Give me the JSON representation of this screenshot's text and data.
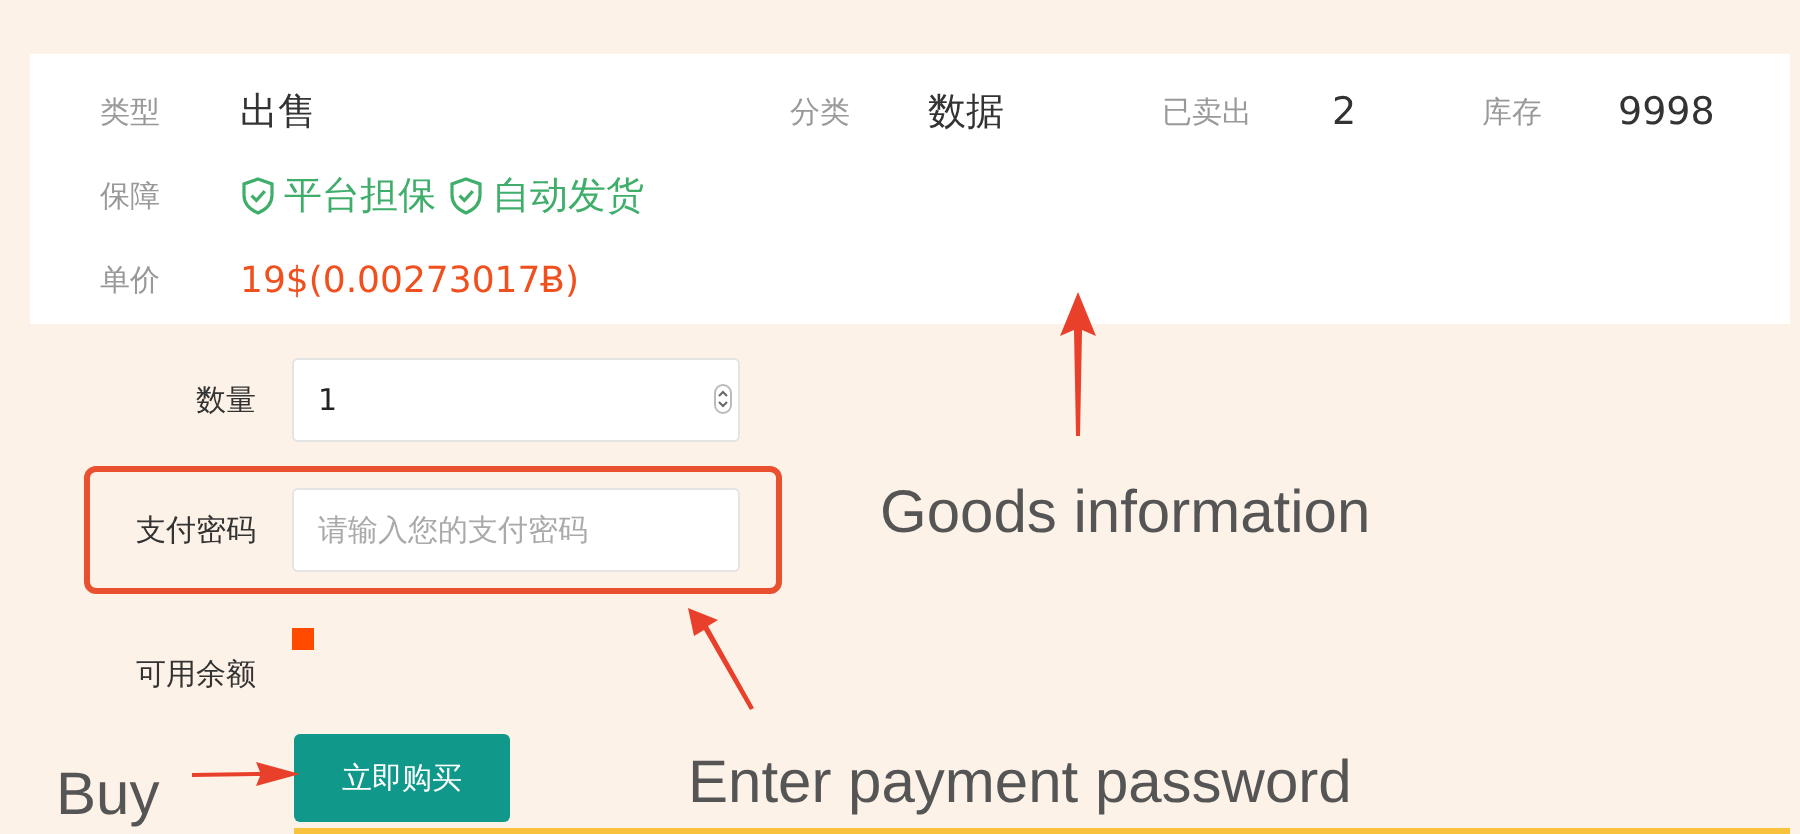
{
  "info": {
    "row1": [
      {
        "label": "类型",
        "value": "出售"
      },
      {
        "label": "分类",
        "value": "数据"
      },
      {
        "label": "已卖出",
        "value": "2"
      },
      {
        "label": "库存",
        "value": "9998"
      }
    ],
    "guarantee": {
      "label": "保障",
      "items": [
        "平台担保",
        "自动发货"
      ]
    },
    "price": {
      "label": "单价",
      "value": "19$(0.00273017Ƀ)"
    }
  },
  "form": {
    "quantity": {
      "label": "数量",
      "value": "1"
    },
    "password": {
      "label": "支付密码",
      "placeholder": "请输入您的支付密码",
      "highlighted": true
    },
    "balance": {
      "label": "可用余额",
      "color": "#ff4a00"
    },
    "buy_button": "立即购买"
  },
  "annotations": [
    {
      "kind": "up",
      "text": "Goods information"
    },
    {
      "kind": "right",
      "text": "Buy"
    },
    {
      "kind": "upleft",
      "text": "Enter payment password"
    }
  ]
}
